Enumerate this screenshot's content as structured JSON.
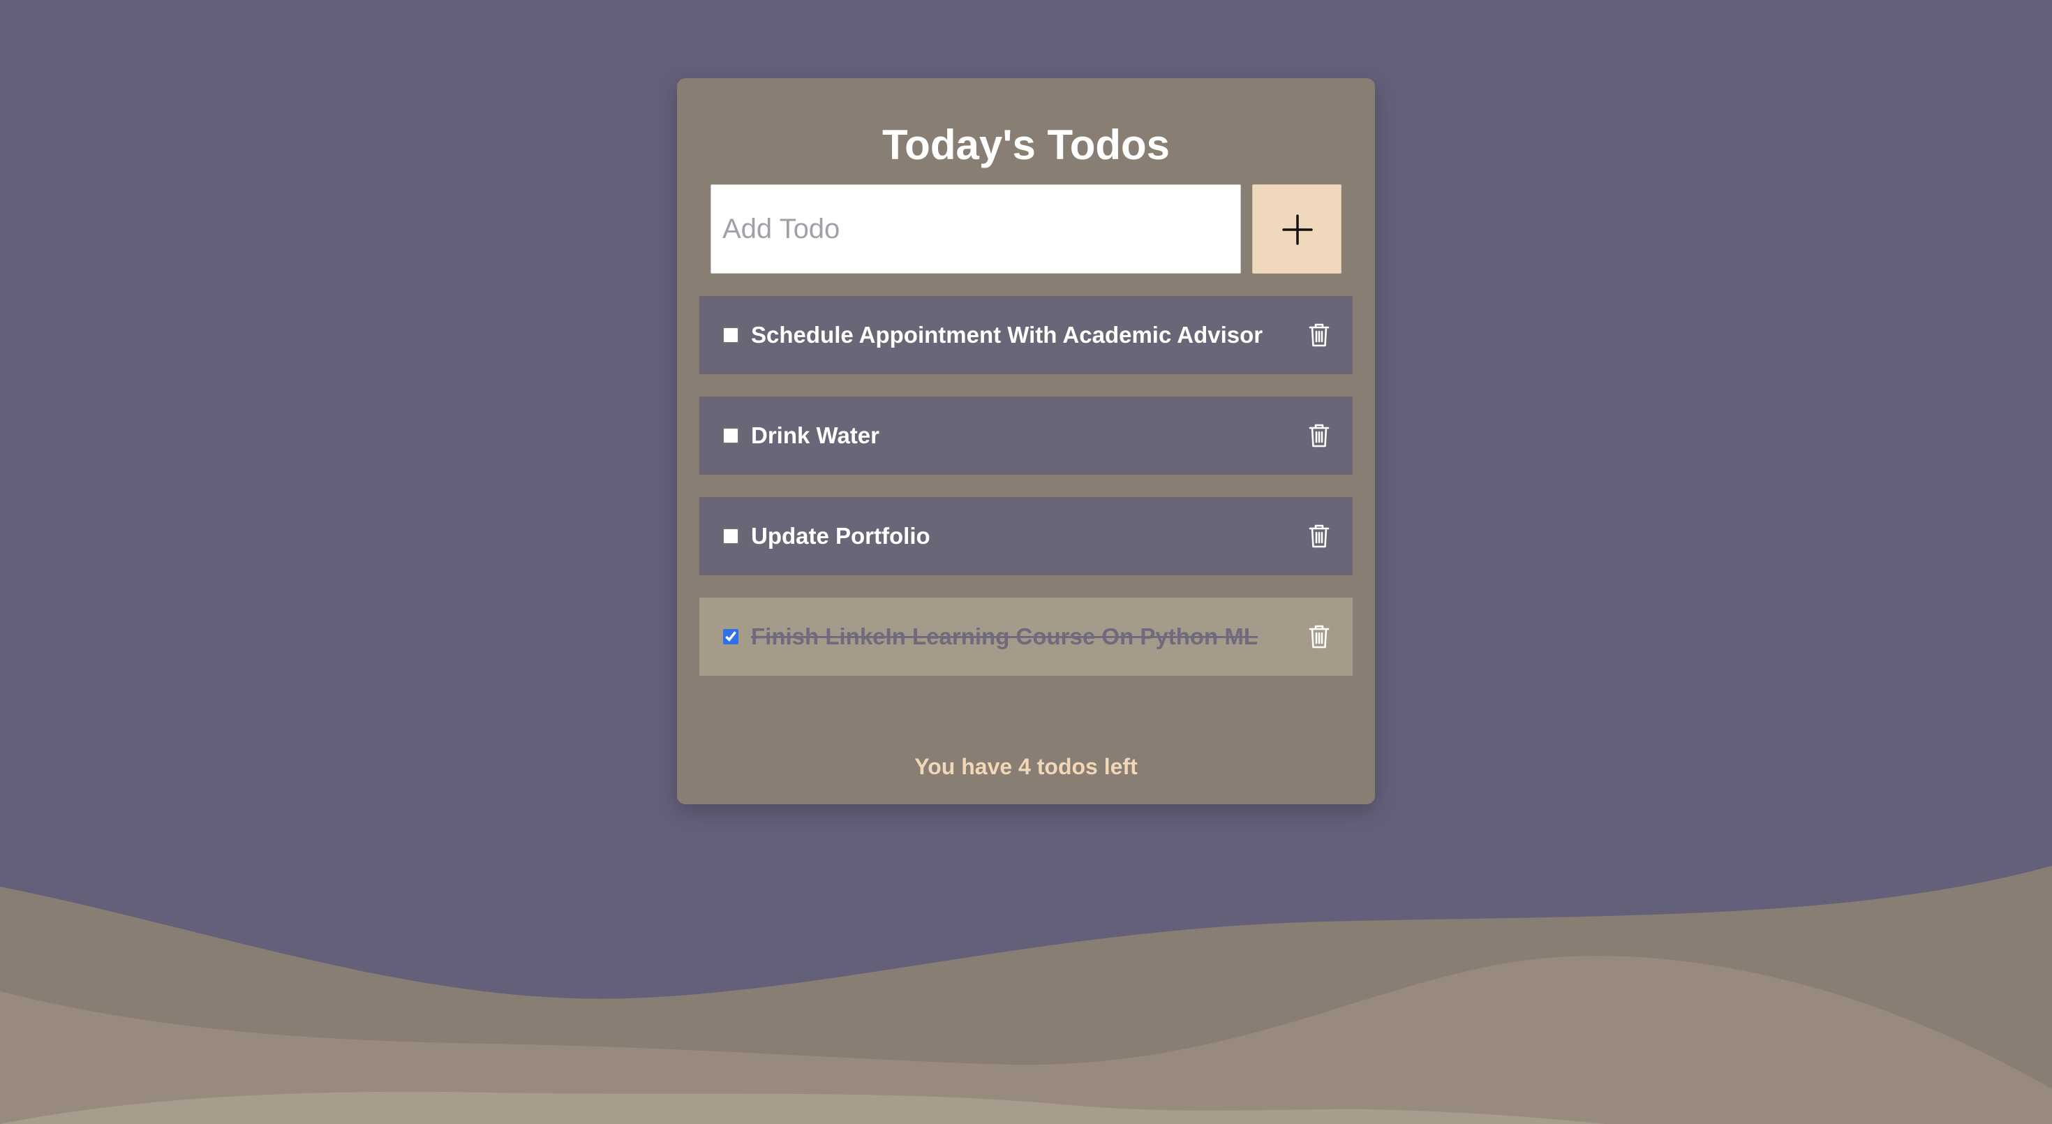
{
  "header": {
    "title": "Today's Todos"
  },
  "add_form": {
    "placeholder": "Add Todo",
    "value": "",
    "add_button_icon": "plus-icon"
  },
  "todos": [
    {
      "text": "Schedule Appointment With Academic Advisor",
      "completed": false,
      "delete_icon": "trash-icon"
    },
    {
      "text": "Drink Water",
      "completed": false,
      "delete_icon": "trash-icon"
    },
    {
      "text": "Update Portfolio",
      "completed": false,
      "delete_icon": "trash-icon"
    },
    {
      "text": "Finish LinkeIn Learning Course On Python ML",
      "completed": true,
      "delete_icon": "trash-icon"
    }
  ],
  "footer": {
    "status": "You have 4 todos left"
  },
  "colors": {
    "background": "#656079",
    "card": "#887e74",
    "todo_item": "#6b6578",
    "todo_item_done": "#a59b8b",
    "add_button": "#efd8bb",
    "footer_text": "#f1d7b7",
    "wave_back": "#887e74",
    "wave_middle": "#988b7d",
    "wave_front": "#a79d8d"
  }
}
